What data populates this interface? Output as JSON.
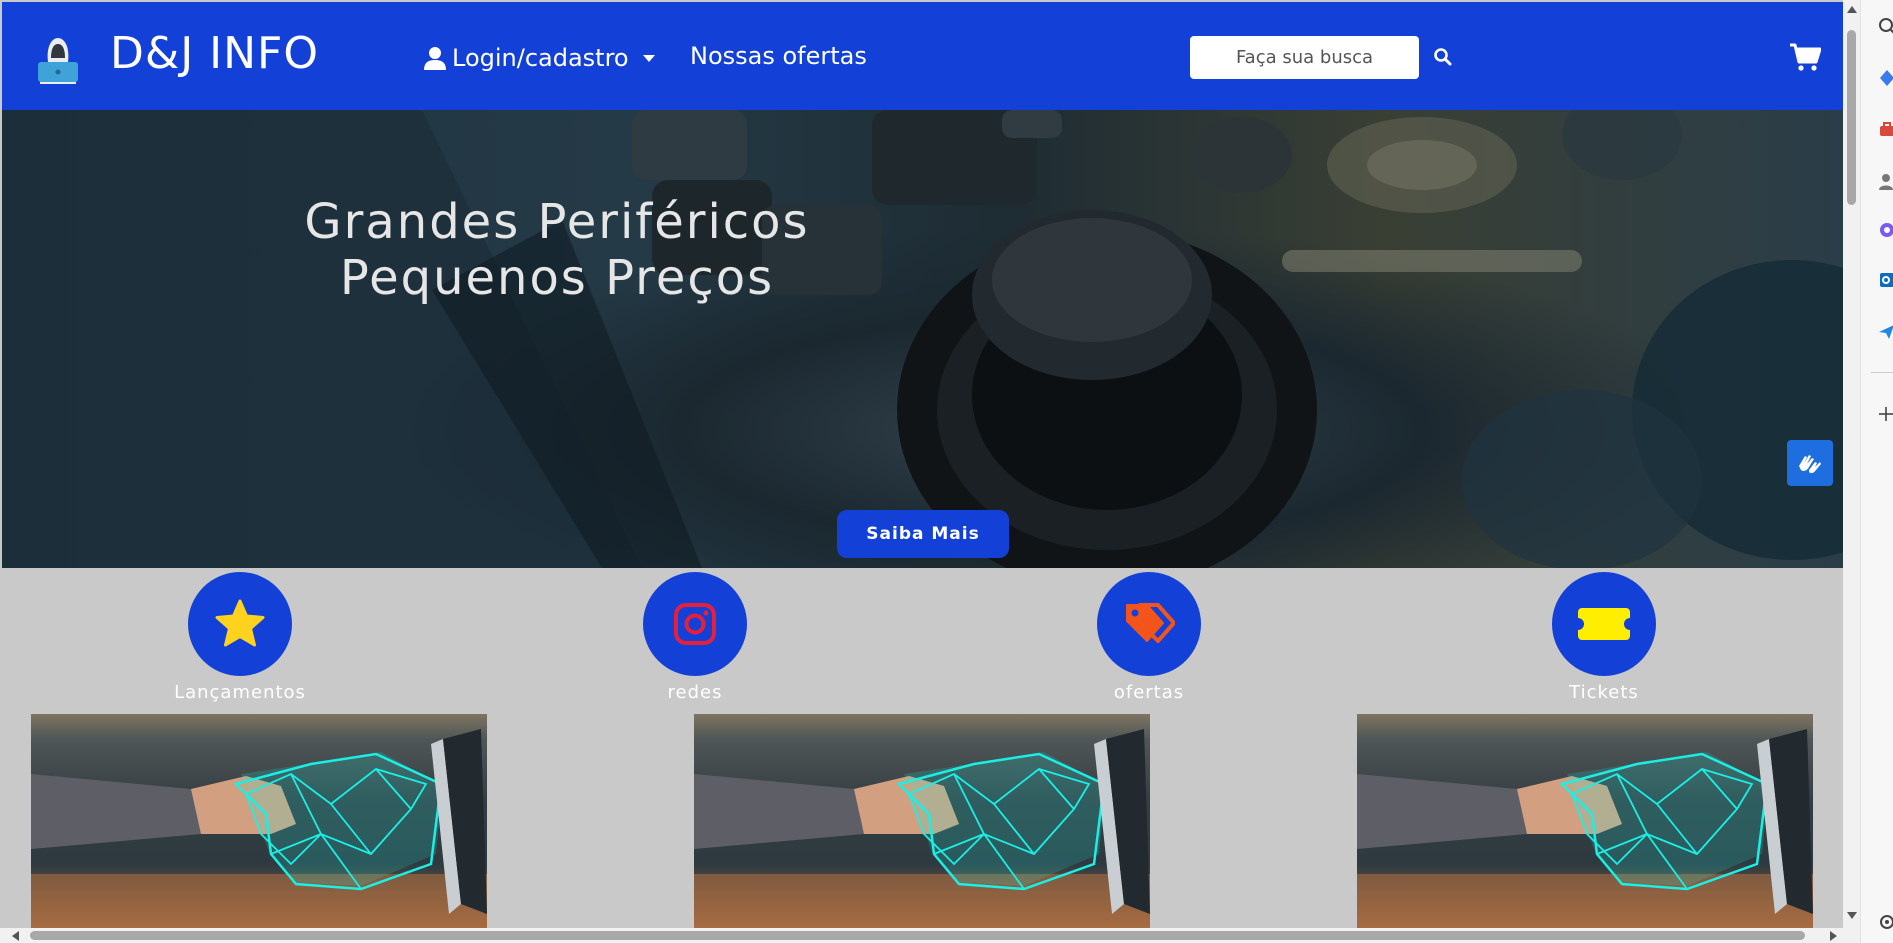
{
  "brand": {
    "name": "D&J INFO"
  },
  "nav": {
    "login_label": "Login/cadastro",
    "offers_label": "Nossas ofertas"
  },
  "search": {
    "placeholder": "Faça sua busca"
  },
  "hero": {
    "title_line1": "Grandes Periféricos",
    "title_line2": "Pequenos Preços",
    "button_label": "Saiba Mais"
  },
  "categories": [
    {
      "label": "Lançamentos",
      "icon": "star-icon",
      "icon_color": "#ffd21f"
    },
    {
      "label": "redes",
      "icon": "instagram-icon",
      "icon_color": "#e6203a"
    },
    {
      "label": "ofertas",
      "icon": "tags-icon",
      "icon_color": "#f3541c"
    },
    {
      "label": "Tickets",
      "icon": "ticket-icon",
      "icon_color": "#ffee00"
    }
  ],
  "colors": {
    "primary": "#1341d8",
    "page_background": "#c9c9c9",
    "hero_text": "#e6e6e6",
    "wireframe_hand": "#19f0e6"
  }
}
